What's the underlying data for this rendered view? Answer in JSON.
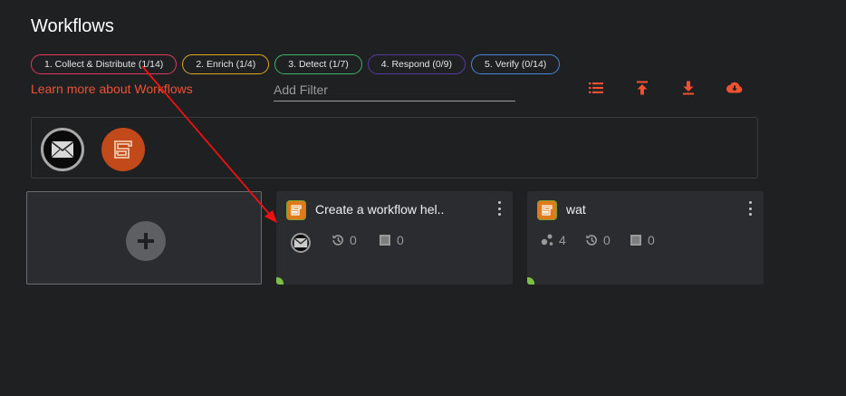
{
  "page": {
    "title": "Workflows"
  },
  "chips": [
    {
      "label": "1. Collect & Distribute (1/14)",
      "color": "#e03a5c"
    },
    {
      "label": "2. Enrich (1/4)",
      "color": "#e0a81e"
    },
    {
      "label": "3. Detect (1/7)",
      "color": "#3fb36a"
    },
    {
      "label": "4. Respond (0/9)",
      "color": "#5a3a9a"
    },
    {
      "label": "5. Verify (0/14)",
      "color": "#4a86d6"
    }
  ],
  "learn_link": "Learn more about Workflows",
  "filter": {
    "placeholder": "Add Filter",
    "value": ""
  },
  "toolbar": {
    "accent": "#ee5233",
    "icons": [
      "list-icon",
      "upload-icon",
      "download-icon",
      "cloud-download-icon"
    ]
  },
  "apps": [
    {
      "name": "email-app-icon"
    },
    {
      "name": "shuffle-app-icon"
    }
  ],
  "workflows": [
    {
      "title": "Create a workflow hel..",
      "stats": {
        "executions": "0",
        "triggers": "0"
      }
    },
    {
      "title": "wat",
      "stats": {
        "apps": "4",
        "executions": "0",
        "triggers": "0"
      }
    }
  ],
  "colors": {
    "background": "#1f2022",
    "card": "#2b2c30",
    "accent": "#ee5233",
    "status_green": "#7bc043",
    "annotation_arrow": "#ee1111"
  }
}
